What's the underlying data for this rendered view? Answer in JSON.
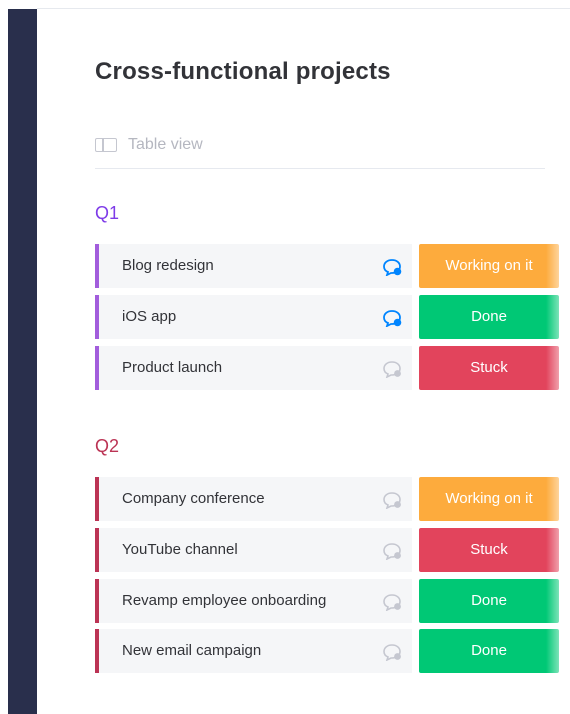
{
  "colors": {
    "sidebar": "#292f4c",
    "q1_accent": "#7e3be8",
    "q1_row_border": "#a25ddc",
    "q2_accent": "#bb3354",
    "status_working": "#fdab3d",
    "status_done": "#00c875",
    "status_stuck": "#e2445c",
    "chat_active": "#0085ff",
    "chat_inactive": "#c5c7d0"
  },
  "board": {
    "title": "Cross-functional projects",
    "view_label": "Table view",
    "view_icon": "table-icon"
  },
  "groups": [
    {
      "title": "Q1",
      "items": [
        {
          "name": "Blog redesign",
          "status": "Working on it",
          "chat_icon": "chat-icon-active"
        },
        {
          "name": "iOS app",
          "status": "Done",
          "chat_icon": "chat-icon-active"
        },
        {
          "name": "Product launch",
          "status": "Stuck",
          "chat_icon": "chat-icon-inactive"
        }
      ]
    },
    {
      "title": "Q2",
      "items": [
        {
          "name": "Company conference",
          "status": "Working on it",
          "chat_icon": "chat-icon-inactive"
        },
        {
          "name": "YouTube channel",
          "status": "Stuck",
          "chat_icon": "chat-icon-inactive"
        },
        {
          "name": "Revamp employee onboarding",
          "status": "Done",
          "chat_icon": "chat-icon-inactive"
        },
        {
          "name": "New email campaign",
          "status": "Done",
          "chat_icon": "chat-icon-inactive"
        }
      ]
    }
  ]
}
